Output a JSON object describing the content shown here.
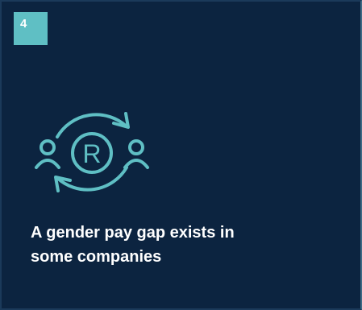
{
  "card": {
    "badge_number": "4",
    "icon_name": "people-exchange-icon",
    "headline": "A gender pay gap exists in some companies"
  },
  "colors": {
    "background": "#0c2440",
    "accent": "#5fbfc4",
    "text": "#ffffff"
  }
}
